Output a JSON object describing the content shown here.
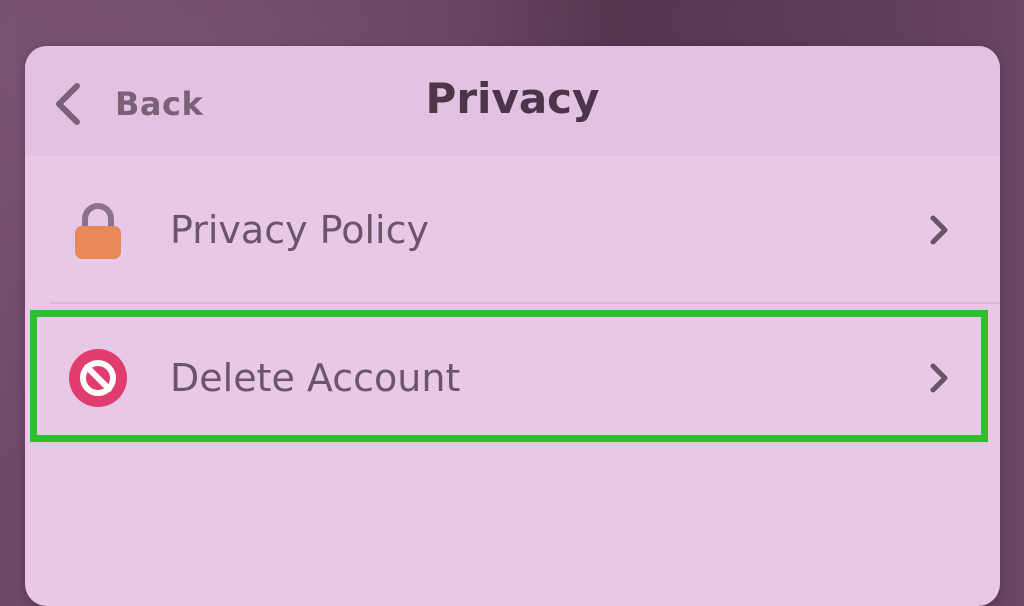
{
  "nav": {
    "back_label": "Back",
    "title": "Privacy"
  },
  "list": {
    "items": [
      {
        "label": "Privacy Policy",
        "icon": "lock-icon",
        "icon_color": "#e8895a"
      },
      {
        "label": "Delete Account",
        "icon": "prohibited-icon",
        "icon_color": "#e03d6e"
      }
    ]
  },
  "colors": {
    "panel_bg": "#e7c8e7",
    "nav_bg": "#e2c2e2",
    "highlight": "#2ec12e",
    "title_text": "#4d3448",
    "row_text": "#6e5468"
  }
}
